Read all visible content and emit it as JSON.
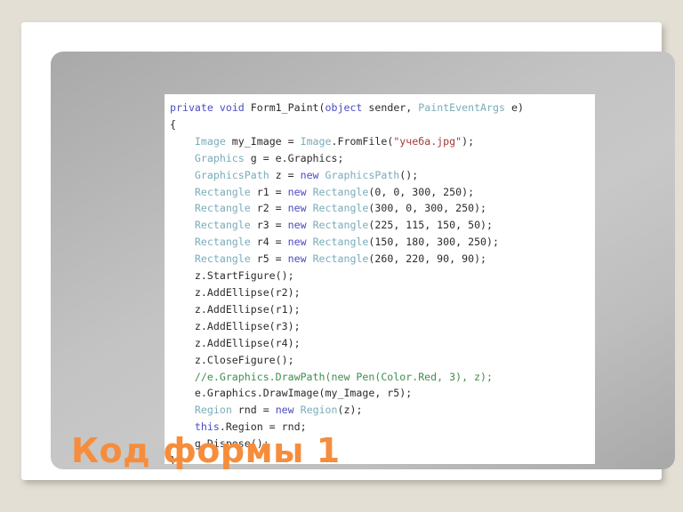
{
  "slide": {
    "title": "Код формы 1",
    "title_color": "#f68d3c",
    "background_color": "#e3dfd4",
    "panel_color": "#bdbdbd",
    "card_color": "#ffffff"
  },
  "code_block": {
    "background_color": "#ffffff",
    "language": "csharp",
    "token_colors": {
      "keyword": "#4b4bc4",
      "type": "#7aacba",
      "string": "#a33a3a",
      "comment": "#3f8f4f",
      "plain": "#2b2b2b"
    },
    "lines": [
      [
        {
          "t": "private",
          "c": "kw"
        },
        {
          "t": " ",
          "c": "pln"
        },
        {
          "t": "void",
          "c": "kw"
        },
        {
          "t": " Form1_Paint(",
          "c": "pln"
        },
        {
          "t": "object",
          "c": "kw"
        },
        {
          "t": " sender, ",
          "c": "pln"
        },
        {
          "t": "PaintEventArgs",
          "c": "typ"
        },
        {
          "t": " e)",
          "c": "pln"
        }
      ],
      [
        {
          "t": "{",
          "c": "pln"
        }
      ],
      [
        {
          "t": "    ",
          "c": "pln"
        },
        {
          "t": "Image",
          "c": "typ"
        },
        {
          "t": " my_Image = ",
          "c": "pln"
        },
        {
          "t": "Image",
          "c": "typ"
        },
        {
          "t": ".FromFile(",
          "c": "pln"
        },
        {
          "t": "\"учеба.jpg\"",
          "c": "str"
        },
        {
          "t": ");",
          "c": "pln"
        }
      ],
      [
        {
          "t": "    ",
          "c": "pln"
        },
        {
          "t": "Graphics",
          "c": "typ"
        },
        {
          "t": " g = e.Graphics;",
          "c": "pln"
        }
      ],
      [
        {
          "t": "    ",
          "c": "pln"
        },
        {
          "t": "GraphicsPath",
          "c": "typ"
        },
        {
          "t": " z = ",
          "c": "pln"
        },
        {
          "t": "new",
          "c": "kw"
        },
        {
          "t": " ",
          "c": "pln"
        },
        {
          "t": "GraphicsPath",
          "c": "typ"
        },
        {
          "t": "();",
          "c": "pln"
        }
      ],
      [
        {
          "t": "    ",
          "c": "pln"
        },
        {
          "t": "Rectangle",
          "c": "typ"
        },
        {
          "t": " r1 = ",
          "c": "pln"
        },
        {
          "t": "new",
          "c": "kw"
        },
        {
          "t": " ",
          "c": "pln"
        },
        {
          "t": "Rectangle",
          "c": "typ"
        },
        {
          "t": "(0, 0, 300, 250);",
          "c": "pln"
        }
      ],
      [
        {
          "t": "    ",
          "c": "pln"
        },
        {
          "t": "Rectangle",
          "c": "typ"
        },
        {
          "t": " r2 = ",
          "c": "pln"
        },
        {
          "t": "new",
          "c": "kw"
        },
        {
          "t": " ",
          "c": "pln"
        },
        {
          "t": "Rectangle",
          "c": "typ"
        },
        {
          "t": "(300, 0, 300, 250);",
          "c": "pln"
        }
      ],
      [
        {
          "t": "    ",
          "c": "pln"
        },
        {
          "t": "Rectangle",
          "c": "typ"
        },
        {
          "t": " r3 = ",
          "c": "pln"
        },
        {
          "t": "new",
          "c": "kw"
        },
        {
          "t": " ",
          "c": "pln"
        },
        {
          "t": "Rectangle",
          "c": "typ"
        },
        {
          "t": "(225, 115, 150, 50);",
          "c": "pln"
        }
      ],
      [
        {
          "t": "    ",
          "c": "pln"
        },
        {
          "t": "Rectangle",
          "c": "typ"
        },
        {
          "t": " r4 = ",
          "c": "pln"
        },
        {
          "t": "new",
          "c": "kw"
        },
        {
          "t": " ",
          "c": "pln"
        },
        {
          "t": "Rectangle",
          "c": "typ"
        },
        {
          "t": "(150, 180, 300, 250);",
          "c": "pln"
        }
      ],
      [
        {
          "t": "    ",
          "c": "pln"
        },
        {
          "t": "Rectangle",
          "c": "typ"
        },
        {
          "t": " r5 = ",
          "c": "pln"
        },
        {
          "t": "new",
          "c": "kw"
        },
        {
          "t": " ",
          "c": "pln"
        },
        {
          "t": "Rectangle",
          "c": "typ"
        },
        {
          "t": "(260, 220, 90, 90);",
          "c": "pln"
        }
      ],
      [
        {
          "t": "    z.StartFigure();",
          "c": "pln"
        }
      ],
      [
        {
          "t": "    z.AddEllipse(r2);",
          "c": "pln"
        }
      ],
      [
        {
          "t": "    z.AddEllipse(r1);",
          "c": "pln"
        }
      ],
      [
        {
          "t": "    z.AddEllipse(r3);",
          "c": "pln"
        }
      ],
      [
        {
          "t": "    z.AddEllipse(r4);",
          "c": "pln"
        }
      ],
      [
        {
          "t": "    z.CloseFigure();",
          "c": "pln"
        }
      ],
      [
        {
          "t": "    ",
          "c": "pln"
        },
        {
          "t": "//e.Graphics.DrawPath(new Pen(Color.Red, 3), z);",
          "c": "cmt"
        }
      ],
      [
        {
          "t": "    e.Graphics.DrawImage(my_Image, r5);",
          "c": "pln"
        }
      ],
      [
        {
          "t": "    ",
          "c": "pln"
        },
        {
          "t": "Region",
          "c": "typ"
        },
        {
          "t": " rnd = ",
          "c": "pln"
        },
        {
          "t": "new",
          "c": "kw"
        },
        {
          "t": " ",
          "c": "pln"
        },
        {
          "t": "Region",
          "c": "typ"
        },
        {
          "t": "(z);",
          "c": "pln"
        }
      ],
      [
        {
          "t": "    ",
          "c": "pln"
        },
        {
          "t": "this",
          "c": "kw"
        },
        {
          "t": ".Region = rnd;",
          "c": "pln"
        }
      ],
      [
        {
          "t": "    g.Dispose();",
          "c": "pln"
        }
      ],
      [
        {
          "t": "}",
          "c": "pln"
        }
      ]
    ]
  }
}
